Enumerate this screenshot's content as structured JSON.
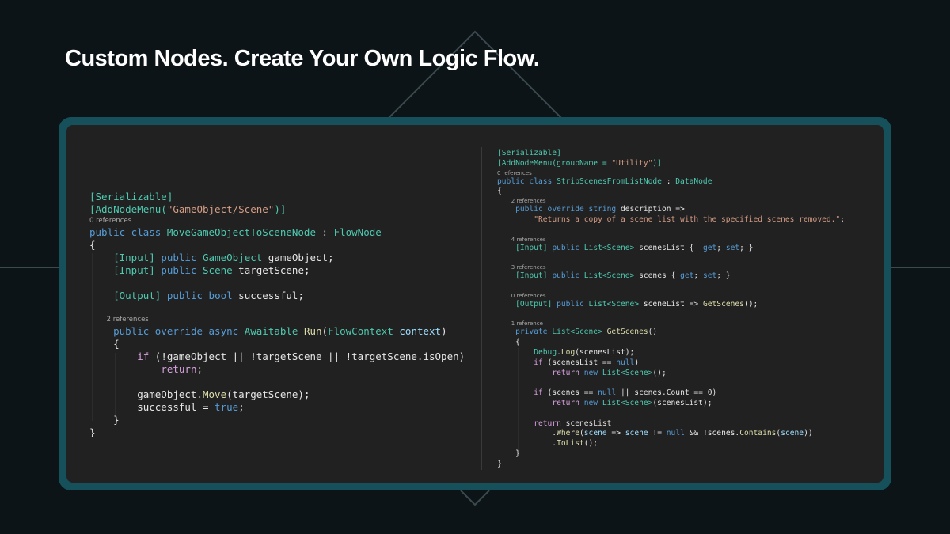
{
  "headline": "Custom Nodes. Create Your Own Logic Flow.",
  "colors": {
    "background": "#0c1418",
    "frame": "#16505a",
    "panel": "#212121",
    "keyword": "#569cd6",
    "type": "#4ec9b0",
    "method": "#dcdcaa",
    "string": "#d69d85",
    "control": "#d8a0df"
  },
  "left_code": [
    {
      "ref": false,
      "tokens": [
        {
          "t": "[Serializable]",
          "c": "ty"
        }
      ]
    },
    {
      "ref": false,
      "tokens": [
        {
          "t": "[AddNodeMenu(",
          "c": "ty"
        },
        {
          "t": "\"GameObject/Scene\"",
          "c": "str"
        },
        {
          "t": ")]",
          "c": "ty"
        }
      ]
    },
    {
      "ref": true,
      "tokens": [
        {
          "t": "0 references",
          "c": "ref"
        }
      ]
    },
    {
      "ref": false,
      "tokens": [
        {
          "t": "public class ",
          "c": "kw"
        },
        {
          "t": "MoveGameObjectToSceneNode",
          "c": "ty"
        },
        {
          "t": " : "
        },
        {
          "t": "FlowNode",
          "c": "ty"
        }
      ]
    },
    {
      "ref": false,
      "tokens": [
        {
          "t": "{"
        }
      ]
    },
    {
      "ref": false,
      "tokens": [
        {
          "t": "    "
        },
        {
          "t": "[Input]",
          "c": "ty"
        },
        {
          "t": " "
        },
        {
          "t": "public ",
          "c": "kw"
        },
        {
          "t": "GameObject",
          "c": "ty"
        },
        {
          "t": " gameObject;"
        }
      ]
    },
    {
      "ref": false,
      "tokens": [
        {
          "t": "    "
        },
        {
          "t": "[Input]",
          "c": "ty"
        },
        {
          "t": " "
        },
        {
          "t": "public ",
          "c": "kw"
        },
        {
          "t": "Scene",
          "c": "ty"
        },
        {
          "t": " targetScene;"
        }
      ]
    },
    {
      "ref": false,
      "tokens": [
        {
          "t": " "
        }
      ]
    },
    {
      "ref": false,
      "tokens": [
        {
          "t": "    "
        },
        {
          "t": "[Output]",
          "c": "ty"
        },
        {
          "t": " "
        },
        {
          "t": "public bool",
          "c": "kw"
        },
        {
          "t": " successful;"
        }
      ]
    },
    {
      "ref": false,
      "tokens": [
        {
          "t": " "
        }
      ]
    },
    {
      "ref": true,
      "tokens": [
        {
          "t": "        2 references",
          "c": "ref"
        }
      ]
    },
    {
      "ref": false,
      "tokens": [
        {
          "t": "    "
        },
        {
          "t": "public override async ",
          "c": "kw"
        },
        {
          "t": "Awaitable",
          "c": "ty"
        },
        {
          "t": " "
        },
        {
          "t": "Run",
          "c": "fn"
        },
        {
          "t": "("
        },
        {
          "t": "FlowContext",
          "c": "ty"
        },
        {
          "t": " "
        },
        {
          "t": "context",
          "c": "prm"
        },
        {
          "t": ")"
        }
      ]
    },
    {
      "ref": false,
      "tokens": [
        {
          "t": "    {"
        }
      ]
    },
    {
      "ref": false,
      "tokens": [
        {
          "t": "        "
        },
        {
          "t": "if",
          "c": "ctl"
        },
        {
          "t": " (!gameObject || !targetScene || !targetScene.isOpen)"
        }
      ]
    },
    {
      "ref": false,
      "tokens": [
        {
          "t": "            "
        },
        {
          "t": "return",
          "c": "ctl"
        },
        {
          "t": ";"
        }
      ]
    },
    {
      "ref": false,
      "tokens": [
        {
          "t": " "
        }
      ]
    },
    {
      "ref": false,
      "tokens": [
        {
          "t": "        gameObject."
        },
        {
          "t": "Move",
          "c": "fn"
        },
        {
          "t": "(targetScene);"
        }
      ]
    },
    {
      "ref": false,
      "tokens": [
        {
          "t": "        successful = "
        },
        {
          "t": "true",
          "c": "kw"
        },
        {
          "t": ";"
        }
      ]
    },
    {
      "ref": false,
      "tokens": [
        {
          "t": "    }"
        }
      ]
    },
    {
      "ref": false,
      "tokens": [
        {
          "t": "}"
        }
      ]
    }
  ],
  "right_code": [
    {
      "ref": false,
      "tokens": [
        {
          "t": "[Serializable]",
          "c": "ty"
        }
      ]
    },
    {
      "ref": false,
      "tokens": [
        {
          "t": "[AddNodeMenu(groupName = ",
          "c": "ty"
        },
        {
          "t": "\"Utility\"",
          "c": "str"
        },
        {
          "t": ")]",
          "c": "ty"
        }
      ]
    },
    {
      "ref": true,
      "tokens": [
        {
          "t": "0 references",
          "c": "ref"
        }
      ]
    },
    {
      "ref": false,
      "tokens": [
        {
          "t": "public class ",
          "c": "kw"
        },
        {
          "t": "StripScenesFromListNode",
          "c": "ty"
        },
        {
          "t": " : "
        },
        {
          "t": "DataNode",
          "c": "ty"
        }
      ]
    },
    {
      "ref": false,
      "tokens": [
        {
          "t": "{"
        }
      ]
    },
    {
      "ref": true,
      "tokens": [
        {
          "t": "        2 references",
          "c": "ref"
        }
      ]
    },
    {
      "ref": false,
      "tokens": [
        {
          "t": "    "
        },
        {
          "t": "public override string",
          "c": "kw"
        },
        {
          "t": " description =>"
        }
      ]
    },
    {
      "ref": false,
      "tokens": [
        {
          "t": "        "
        },
        {
          "t": "\"Returns a copy of a scene list with the specified scenes removed.\"",
          "c": "str"
        },
        {
          "t": ";"
        }
      ]
    },
    {
      "ref": false,
      "tokens": [
        {
          "t": " "
        }
      ]
    },
    {
      "ref": true,
      "tokens": [
        {
          "t": "        4 references",
          "c": "ref"
        }
      ]
    },
    {
      "ref": false,
      "tokens": [
        {
          "t": "    "
        },
        {
          "t": "[Input]",
          "c": "ty"
        },
        {
          "t": " "
        },
        {
          "t": "public ",
          "c": "kw"
        },
        {
          "t": "List<Scene>",
          "c": "ty"
        },
        {
          "t": " scenesList {  "
        },
        {
          "t": "get",
          "c": "kw"
        },
        {
          "t": "; "
        },
        {
          "t": "set",
          "c": "kw"
        },
        {
          "t": "; }"
        }
      ]
    },
    {
      "ref": false,
      "tokens": [
        {
          "t": " "
        }
      ]
    },
    {
      "ref": true,
      "tokens": [
        {
          "t": "        3 references",
          "c": "ref"
        }
      ]
    },
    {
      "ref": false,
      "tokens": [
        {
          "t": "    "
        },
        {
          "t": "[Input]",
          "c": "ty"
        },
        {
          "t": " "
        },
        {
          "t": "public ",
          "c": "kw"
        },
        {
          "t": "List<Scene>",
          "c": "ty"
        },
        {
          "t": " scenes { "
        },
        {
          "t": "get",
          "c": "kw"
        },
        {
          "t": "; "
        },
        {
          "t": "set",
          "c": "kw"
        },
        {
          "t": "; }"
        }
      ]
    },
    {
      "ref": false,
      "tokens": [
        {
          "t": " "
        }
      ]
    },
    {
      "ref": true,
      "tokens": [
        {
          "t": "        0 references",
          "c": "ref"
        }
      ]
    },
    {
      "ref": false,
      "tokens": [
        {
          "t": "    "
        },
        {
          "t": "[Output]",
          "c": "ty"
        },
        {
          "t": " "
        },
        {
          "t": "public ",
          "c": "kw"
        },
        {
          "t": "List<Scene>",
          "c": "ty"
        },
        {
          "t": " sceneList => "
        },
        {
          "t": "GetScenes",
          "c": "fn"
        },
        {
          "t": "();"
        }
      ]
    },
    {
      "ref": false,
      "tokens": [
        {
          "t": " "
        }
      ]
    },
    {
      "ref": true,
      "tokens": [
        {
          "t": "        1 reference",
          "c": "ref"
        }
      ]
    },
    {
      "ref": false,
      "tokens": [
        {
          "t": "    "
        },
        {
          "t": "private ",
          "c": "kw"
        },
        {
          "t": "List<Scene>",
          "c": "ty"
        },
        {
          "t": " "
        },
        {
          "t": "GetScenes",
          "c": "fn"
        },
        {
          "t": "()"
        }
      ]
    },
    {
      "ref": false,
      "tokens": [
        {
          "t": "    {"
        }
      ]
    },
    {
      "ref": false,
      "tokens": [
        {
          "t": "        "
        },
        {
          "t": "Debug",
          "c": "ty"
        },
        {
          "t": "."
        },
        {
          "t": "Log",
          "c": "fn"
        },
        {
          "t": "(scenesList);"
        }
      ]
    },
    {
      "ref": false,
      "tokens": [
        {
          "t": "        "
        },
        {
          "t": "if",
          "c": "ctl"
        },
        {
          "t": " (scenesList == "
        },
        {
          "t": "null",
          "c": "kw"
        },
        {
          "t": ")"
        }
      ]
    },
    {
      "ref": false,
      "tokens": [
        {
          "t": "            "
        },
        {
          "t": "return",
          "c": "ctl"
        },
        {
          "t": " "
        },
        {
          "t": "new ",
          "c": "kw"
        },
        {
          "t": "List<Scene>",
          "c": "ty"
        },
        {
          "t": "();"
        }
      ]
    },
    {
      "ref": false,
      "tokens": [
        {
          "t": " "
        }
      ]
    },
    {
      "ref": false,
      "tokens": [
        {
          "t": "        "
        },
        {
          "t": "if",
          "c": "ctl"
        },
        {
          "t": " (scenes == "
        },
        {
          "t": "null",
          "c": "kw"
        },
        {
          "t": " || scenes.Count == 0)"
        }
      ]
    },
    {
      "ref": false,
      "tokens": [
        {
          "t": "            "
        },
        {
          "t": "return",
          "c": "ctl"
        },
        {
          "t": " "
        },
        {
          "t": "new ",
          "c": "kw"
        },
        {
          "t": "List<Scene>",
          "c": "ty"
        },
        {
          "t": "(scenesList);"
        }
      ]
    },
    {
      "ref": false,
      "tokens": [
        {
          "t": " "
        }
      ]
    },
    {
      "ref": false,
      "tokens": [
        {
          "t": "        "
        },
        {
          "t": "return",
          "c": "ctl"
        },
        {
          "t": " scenesList"
        }
      ]
    },
    {
      "ref": false,
      "tokens": [
        {
          "t": "            ."
        },
        {
          "t": "Where",
          "c": "fn"
        },
        {
          "t": "("
        },
        {
          "t": "scene",
          "c": "prm"
        },
        {
          "t": " => "
        },
        {
          "t": "scene",
          "c": "prm"
        },
        {
          "t": " != "
        },
        {
          "t": "null",
          "c": "kw"
        },
        {
          "t": " && !scenes."
        },
        {
          "t": "Contains",
          "c": "fn"
        },
        {
          "t": "("
        },
        {
          "t": "scene",
          "c": "prm"
        },
        {
          "t": "))"
        }
      ]
    },
    {
      "ref": false,
      "tokens": [
        {
          "t": "            ."
        },
        {
          "t": "ToList",
          "c": "fn"
        },
        {
          "t": "();"
        }
      ]
    },
    {
      "ref": false,
      "tokens": [
        {
          "t": "    }"
        }
      ]
    },
    {
      "ref": false,
      "tokens": [
        {
          "t": "}"
        }
      ]
    }
  ]
}
